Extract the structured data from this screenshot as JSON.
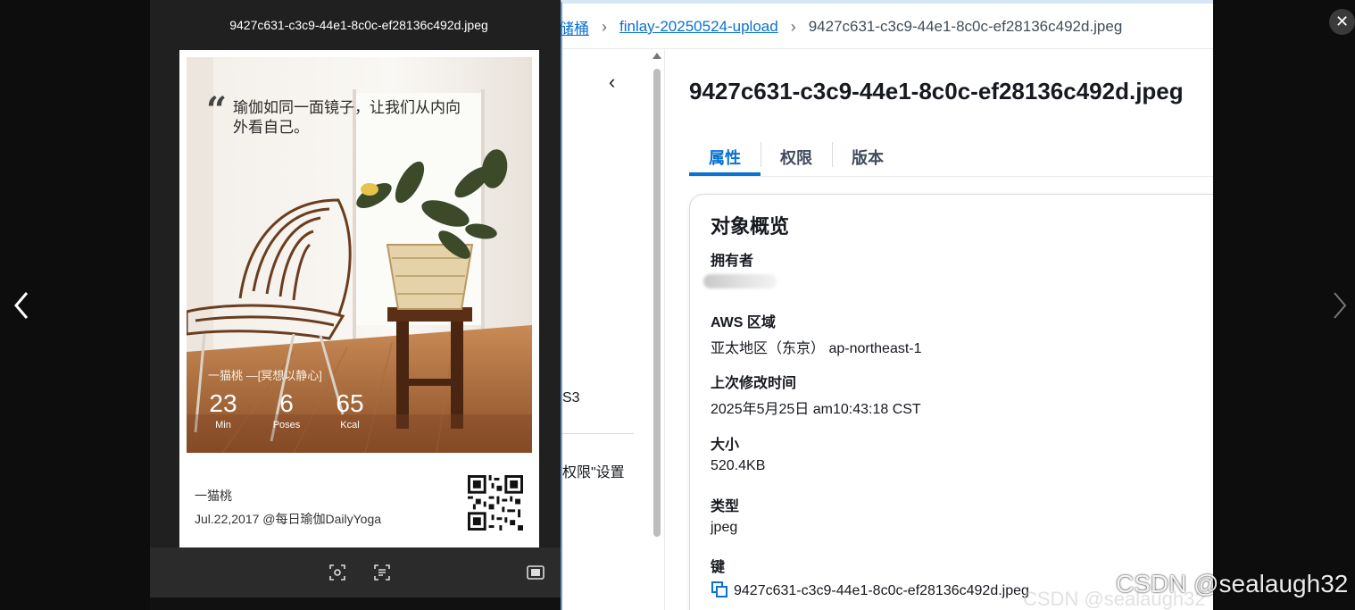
{
  "lightbox": {
    "close_glyph": "✕",
    "prev_icon": "chevron-left-icon",
    "next_icon": "chevron-right-icon"
  },
  "breadcrumb": {
    "bucket_fragment": "储桶",
    "folder": "finlay-20250524-upload",
    "current": "9427c631-c3c9-44e1-8c0c-ef28136c492d.jpeg"
  },
  "sidebar": {
    "collapse_glyph": "‹",
    "fragment_s3": "S3",
    "fragment_permissions": "权限\"设置"
  },
  "object": {
    "title": "9427c631-c3c9-44e1-8c0c-ef28136c492d.jpeg",
    "tabs": [
      {
        "label": "属性",
        "active": true
      },
      {
        "label": "权限",
        "active": false
      },
      {
        "label": "版本",
        "active": false
      }
    ],
    "overview": {
      "heading": "对象概览",
      "owner_label": "拥有者",
      "region_label": "AWS 区域",
      "region_value": "亚太地区（东京） ap-northeast-1",
      "modified_label": "上次修改时间",
      "modified_value": "2025年5月25日 am10:43:18 CST",
      "size_label": "大小",
      "size_value": "520.4KB",
      "type_label": "类型",
      "type_value": "jpeg",
      "key_label": "键",
      "key_value": "9427c631-c3c9-44e1-8c0c-ef28136c492d.jpeg"
    }
  },
  "viewer": {
    "filename": "9427c631-c3c9-44e1-8c0c-ef28136c492d.jpeg",
    "toolbar_icons": [
      "scan-icon",
      "text-recognize-icon",
      "screenshot-icon"
    ],
    "poster": {
      "quote_mark": "“",
      "quote": "瑜伽如同一面镜子，让我们从内向外看自己。",
      "label": "一猫桃 —[冥想以静心]",
      "stats": [
        {
          "value": "23",
          "unit": "Min"
        },
        {
          "value": "6",
          "unit": "Poses"
        },
        {
          "value": "65",
          "unit": "Kcal"
        }
      ],
      "author": "一猫桃",
      "date_line": "Jul.22,2017 @每日瑜伽DailyYoga"
    }
  },
  "watermark": {
    "primary": "CSDN @sealaugh32",
    "secondary": "CSDN @sealaugh32"
  },
  "colors": {
    "link": "#0972d3",
    "text": "#16191f",
    "overlay_bg": "#0d0d0d"
  }
}
